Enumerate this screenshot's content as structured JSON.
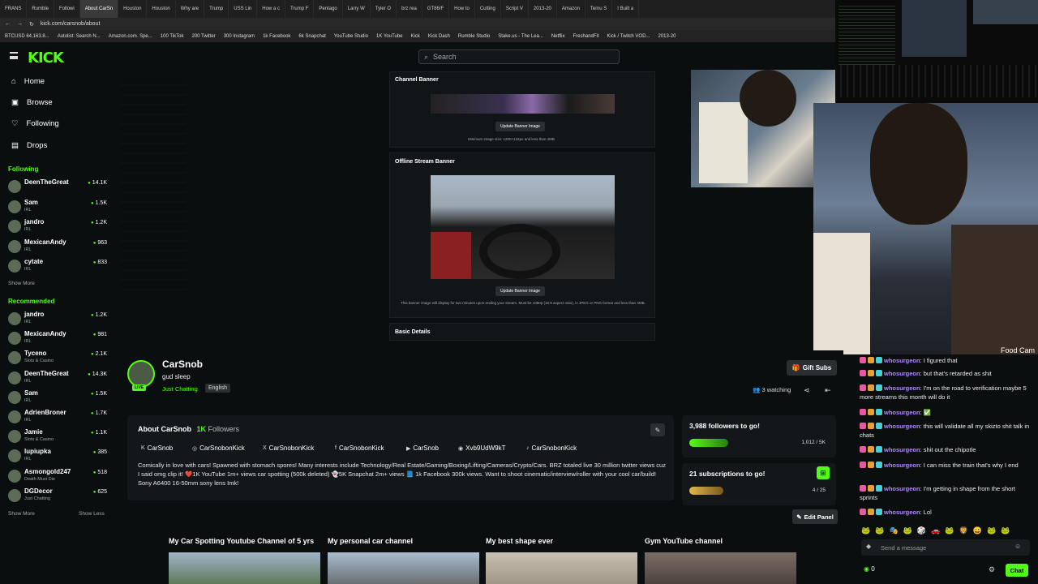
{
  "browser": {
    "tabs": [
      "FRANS",
      "Rumble",
      "Followi",
      "About CarSn",
      "Houston",
      "Houston",
      "Why are",
      "Trump",
      "USS Lin",
      "How a c",
      "Trump F",
      "Pentago",
      "Larry W",
      "Tyler O",
      "brz rea",
      "GT86/F",
      "How to",
      "Cutting",
      "Script V",
      "2013-20",
      "Amazon",
      "Temu S",
      "I Built a"
    ],
    "active_tab_index": 3,
    "url": "kick.com/carsnob/about",
    "bookmarks": [
      "BTCUSD 64,163.8...",
      "Autolist: Search N...",
      "Amazon.com. Spe...",
      "100 TikTok",
      "200 Twitter",
      "300 Instagram",
      "1k Facebook",
      "6k Snapchat",
      "YouTube Studio",
      "1K YouTube",
      "Kick",
      "Kick Dash",
      "Rumble Studio",
      "Stake.us - The Lea...",
      "Netflix",
      "FreshandFit",
      "Kick / Twitch VOD...",
      "2013-20"
    ]
  },
  "header": {
    "logo": "KICK",
    "search_placeholder": "Search"
  },
  "nav": [
    {
      "label": "Home",
      "icon": "home-icon",
      "glyph": "⌂"
    },
    {
      "label": "Browse",
      "icon": "browse-icon",
      "glyph": "▣"
    },
    {
      "label": "Following",
      "icon": "heart-icon",
      "glyph": "♡"
    },
    {
      "label": "Drops",
      "icon": "drops-icon",
      "glyph": "▤"
    }
  ],
  "following": {
    "title": "Following",
    "items": [
      {
        "name": "DeenTheGreat",
        "category": "",
        "count": "14.1K"
      },
      {
        "name": "Sam",
        "category": "IRL",
        "count": "1.5K"
      },
      {
        "name": "jandro",
        "category": "IRL",
        "count": "1.2K"
      },
      {
        "name": "MexicanAndy",
        "category": "IRL",
        "count": "963"
      },
      {
        "name": "cytate",
        "category": "IRL",
        "count": "833"
      }
    ],
    "more": "Show More"
  },
  "recommended": {
    "title": "Recommended",
    "items": [
      {
        "name": "jandro",
        "category": "IRL",
        "count": "1.2K"
      },
      {
        "name": "MexicanAndy",
        "category": "IRL",
        "count": "981"
      },
      {
        "name": "Tyceno",
        "category": "Slots & Casino",
        "count": "2.1K"
      },
      {
        "name": "DeenTheGreat",
        "category": "IRL",
        "count": "14.3K"
      },
      {
        "name": "Sam",
        "category": "IRL",
        "count": "1.5K"
      },
      {
        "name": "AdrienBroner",
        "category": "IRL",
        "count": "1.7K"
      },
      {
        "name": "Jamie",
        "category": "Slots & Casino",
        "count": "1.1K"
      },
      {
        "name": "lupiupka",
        "category": "IRL",
        "count": "385"
      },
      {
        "name": "Asmongold247",
        "category": "Death Must Die",
        "count": "518"
      },
      {
        "name": "DGDecor",
        "category": "Just Chatting",
        "count": "625"
      }
    ],
    "more": "Show More",
    "less": "Show Less"
  },
  "settings": {
    "channel_banner": "Channel Banner",
    "update_banner": "Update Banner Image",
    "banner_hint": "Minimum image size: 1200×134px and less than 4MB",
    "offline_banner": "Offline Stream Banner",
    "offline_hint": "This banner image will display for two minutes upon ending your stream. Must be 1080p (16:9 aspect ratio), in JPEG or PNG format and less than 4MB.",
    "basic_details": "Basic Details"
  },
  "profile": {
    "name": "CarSnob",
    "tagline": "gud sleep",
    "category": "Just Chatting",
    "language": "English",
    "live": "LIVE",
    "gift_subs": "Gift Subs",
    "watching": "3 watching",
    "about_label": "About CarSnob",
    "followers_count": "1K",
    "followers_label": "Followers",
    "socials": [
      {
        "icon": "kick-icon",
        "glyph": "K",
        "label": "CarSnob"
      },
      {
        "icon": "instagram-icon",
        "glyph": "◎",
        "label": "CarSnobonKick"
      },
      {
        "icon": "x-icon",
        "glyph": "X",
        "label": "CarSnobonKick"
      },
      {
        "icon": "facebook-icon",
        "glyph": "f",
        "label": "CarSnobonKick"
      },
      {
        "icon": "youtube-icon",
        "glyph": "▶",
        "label": "CarSnob"
      },
      {
        "icon": "discord-icon",
        "glyph": "◉",
        "label": "Xvb9UdW9kT"
      },
      {
        "icon": "tiktok-icon",
        "glyph": "♪",
        "label": "CarSnobonKick"
      }
    ],
    "description": "Comically in love with cars! Spawned with stomach spores! Many interests include Technology/Real Estate/Gaming/Boxing/Lifting/Cameras/Crypto/Cars. BRZ totaled live 30 million twitter views cuz I said omg clip it! ❤️1K YouTube 1m+ views car spotting (500k deleted) 👻5K Snapchat 2m+ views 📘 1k Facebook 300k views. Want to shoot cinematic/interview/roller with your cool car/build! Sony A6400 16-50mm sony lens Imk!",
    "goals": [
      {
        "title": "3,988 followers to go!",
        "value": "1,012 / 5K",
        "progress": 0.2
      },
      {
        "title": "21 subscriptions to go!",
        "value": "4 / 25",
        "progress": 0.16
      }
    ],
    "edit_panel": "Edit Panel",
    "panels": [
      "My Car Spotting Youtube Channel of 5 yrs",
      "My personal car channel",
      "My best shape ever",
      "Gym YouTube channel"
    ]
  },
  "chat": {
    "messages": [
      {
        "user": "whosurgeon",
        "text": "I figured that"
      },
      {
        "user": "whosurgeon",
        "text": "but that's retarded as shit"
      },
      {
        "user": "whosurgeon",
        "text": "I'm on the road to verification maybe 5 more streams this month will do it"
      },
      {
        "user": "whosurgeon",
        "text": "✅"
      },
      {
        "user": "whosurgeon",
        "text": "this will validate all my skizto shit talk in chats"
      },
      {
        "user": "whosurgeon",
        "text": "shit out the chipotle"
      },
      {
        "user": "whosurgeon",
        "text": "I can miss the train that's why I end"
      },
      {
        "user": "whosurgeon",
        "text": "I'm getting in shape from the short sprints"
      },
      {
        "user": "whosurgeon",
        "text": "Lol"
      }
    ],
    "input_placeholder": "Send a message",
    "points": "0",
    "send_label": "Chat"
  },
  "overlay": {
    "cam_label": "Food Cam"
  },
  "colors": {
    "accent": "#53fc18",
    "bg": "#0b0e0f",
    "chat_user": "#b388ff"
  }
}
